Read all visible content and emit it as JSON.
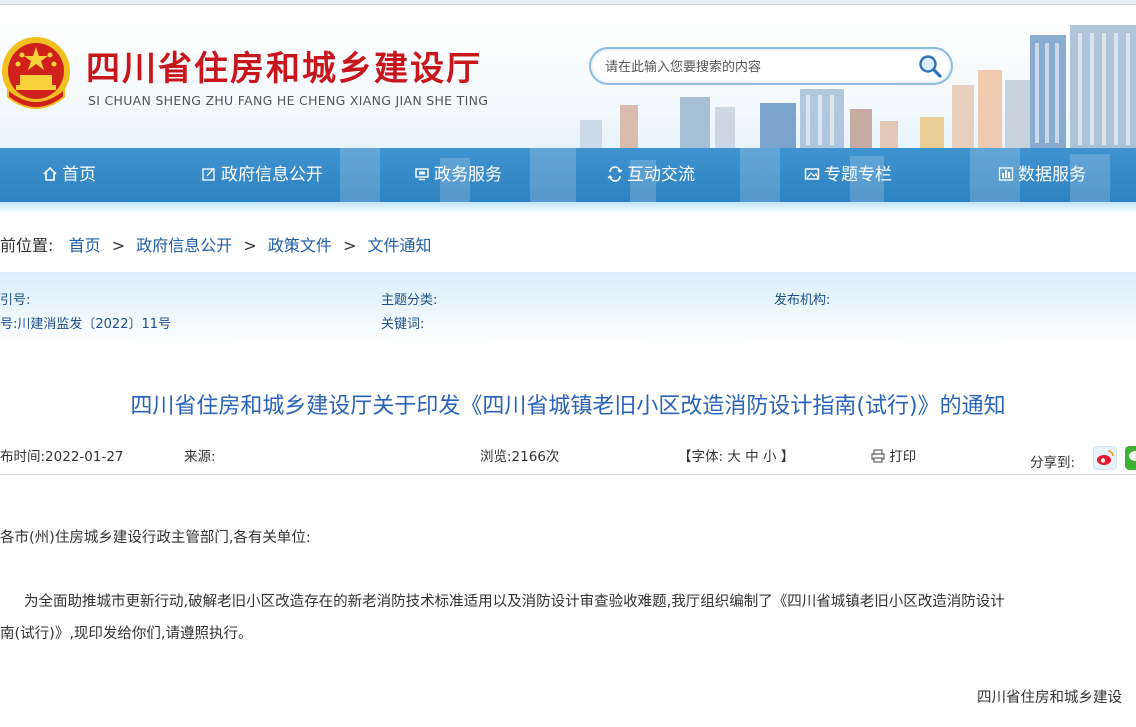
{
  "header": {
    "title": "四川省住房和城乡建设厅",
    "subtitle": "SI CHUAN SHENG ZHU FANG HE CHENG XIANG JIAN SHE TING",
    "search_placeholder": "请在此输入您要搜索的内容"
  },
  "nav": {
    "items": [
      {
        "label": "首页",
        "icon": "home-icon"
      },
      {
        "label": "政府信息公开",
        "icon": "edit-icon"
      },
      {
        "label": "政务服务",
        "icon": "monitor-icon"
      },
      {
        "label": "互动交流",
        "icon": "exchange-icon"
      },
      {
        "label": "专题专栏",
        "icon": "picture-icon"
      },
      {
        "label": "数据服务",
        "icon": "chart-icon"
      }
    ]
  },
  "breadcrumb": {
    "prefix": "前位置:",
    "items": [
      "首页",
      "政府信息公开",
      "政策文件",
      "文件通知"
    ],
    "separator": ">"
  },
  "meta": {
    "index_label": "引号:",
    "doc_no": "号:川建消监发〔2022〕11号",
    "topic_label": "主题分类:",
    "keywords_label": "关键词:",
    "publisher_label": "发布机构:"
  },
  "article": {
    "title": "四川省住房和城乡建设厅关于印发《四川省城镇老旧小区改造消防设计指南(试行)》的通知",
    "publish_time": "布时间:2022-01-27",
    "source": "来源:",
    "views": "浏览:2166次",
    "font_prefix": "【字体:",
    "font_large": "大",
    "font_medium": "中",
    "font_small": "小",
    "font_suffix": "】",
    "print": "打印",
    "share": "分享到:",
    "salutation": "各市(州)住房城乡建设行政主管部门,各有关单位:",
    "para1_line1": "为全面助推城市更新行动,破解老旧小区改造存在的新老消防技术标准适用以及消防设计审查验收难题,我厅组织编制了《四川省城镇老旧小区改造消防设计",
    "para1_line2": "南(试行)》,现印发给你们,请遵照执行。",
    "signature": "四川省住房和城乡建设"
  },
  "colors": {
    "brand_red": "#c8161d",
    "nav_blue": "#3a8dcb",
    "title_blue": "#2a64b8",
    "link_blue": "#1f5ea8"
  }
}
